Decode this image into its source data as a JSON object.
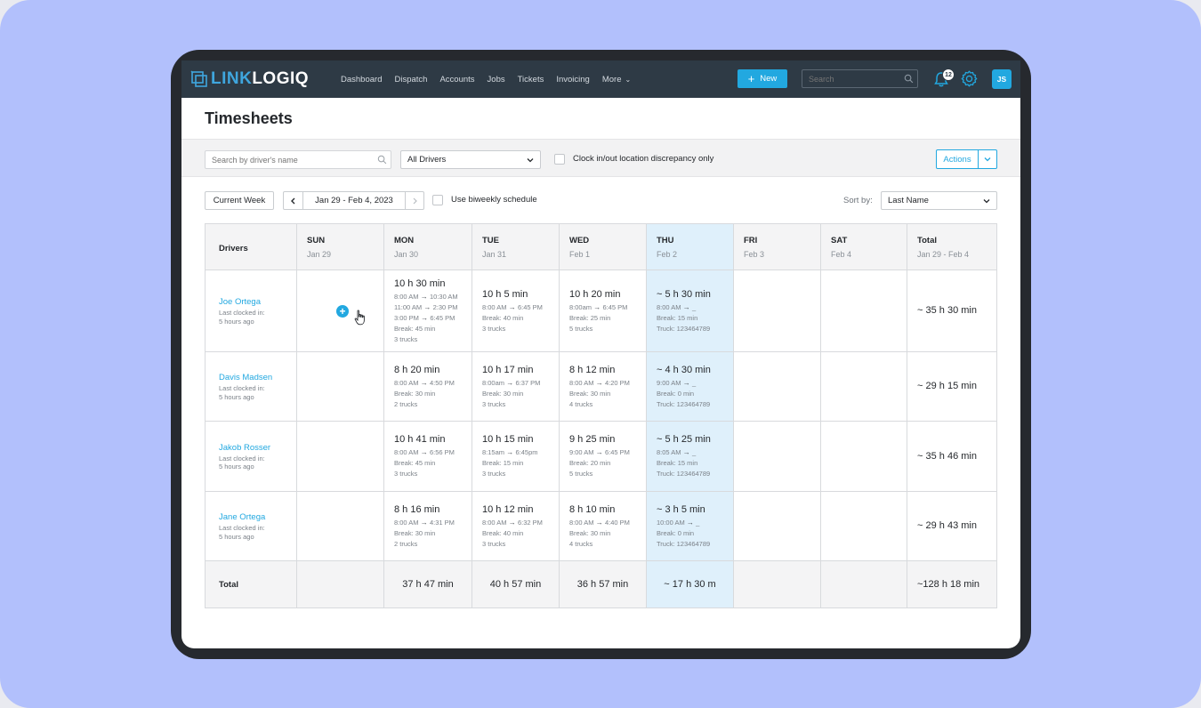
{
  "brand": {
    "logo_part1": "LINK",
    "logo_part2": "LOGIQ"
  },
  "nav": {
    "links": [
      "Dashboard",
      "Dispatch",
      "Accounts",
      "Jobs",
      "Tickets",
      "Invoicing",
      "More"
    ],
    "new_label": "New",
    "search_placeholder": "Search",
    "notification_count": "12",
    "user_initials": "JS"
  },
  "page": {
    "title": "Timesheets"
  },
  "filters": {
    "driver_search_placeholder": "Search by driver's name",
    "drivers_select": "All Drivers",
    "discrepancy_label": "Clock in/out location discrepancy only",
    "actions_label": "Actions"
  },
  "week": {
    "current_week_label": "Current Week",
    "range_label": "Jan 29 - Feb 4, 2023",
    "biweekly_label": "Use biweekly schedule",
    "sort_by_label": "Sort by:",
    "sort_value": "Last Name"
  },
  "table": {
    "drivers_header": "Drivers",
    "total_row_label": "Total",
    "columns": [
      {
        "day": "SUN",
        "date": "Jan 29"
      },
      {
        "day": "MON",
        "date": "Jan 30"
      },
      {
        "day": "TUE",
        "date": "Jan 31"
      },
      {
        "day": "WED",
        "date": "Feb 1"
      },
      {
        "day": "THU",
        "date": "Feb 2"
      },
      {
        "day": "FRI",
        "date": "Feb 3"
      },
      {
        "day": "SAT",
        "date": "Feb 4"
      },
      {
        "day": "Total",
        "date": "Jan 29 - Feb 4"
      }
    ],
    "drivers": [
      {
        "name": "Joe Ortega",
        "last_clocked_label": "Last clocked in:",
        "last_clocked": "5 hours ago",
        "total": "~ 35 h 30 min",
        "days": {
          "mon": {
            "time": "10 h 30 min",
            "shifts": [
              [
                "8:00 AM",
                "10:30 AM"
              ],
              [
                "11:00 AM",
                "2:30 PM"
              ],
              [
                "3:00 PM",
                "6:45 PM"
              ]
            ],
            "break": "Break: 45 min",
            "trucks": "3 trucks"
          },
          "tue": {
            "time": "10 h 5 min",
            "shifts": [
              [
                "8:00 AM",
                "6:45 PM"
              ]
            ],
            "break": "Break: 40 min",
            "trucks": "3 trucks"
          },
          "wed": {
            "time": "10 h 20 min",
            "shifts": [
              [
                "8:00am",
                "6:45 PM"
              ]
            ],
            "break": "Break: 25 min",
            "trucks": "5 trucks"
          },
          "thu": {
            "time": "~ 5 h 30 min",
            "shifts": [
              [
                "8:00 AM",
                "_"
              ]
            ],
            "break": "Break: 15 min",
            "trucks": "Truck: 123464789"
          }
        }
      },
      {
        "name": "Davis Madsen",
        "last_clocked_label": "Last clocked in:",
        "last_clocked": "5 hours ago",
        "total": "~ 29 h 15 min",
        "days": {
          "mon": {
            "time": "8 h 20 min",
            "shifts": [
              [
                "8:00 AM",
                "4:50 PM"
              ]
            ],
            "break": "Break: 30 min",
            "trucks": "2 trucks"
          },
          "tue": {
            "time": "10 h 17 min",
            "shifts": [
              [
                "8:00am",
                "6:37 PM"
              ]
            ],
            "break": "Break: 30 min",
            "trucks": "3 trucks"
          },
          "wed": {
            "time": "8 h 12 min",
            "shifts": [
              [
                "8:00 AM",
                "4:20 PM"
              ]
            ],
            "break": "Break: 30 min",
            "trucks": "4 trucks"
          },
          "thu": {
            "time": "~ 4 h 30 min",
            "shifts": [
              [
                "9:00 AM",
                "_"
              ]
            ],
            "break": "Break: 0 min",
            "trucks": "Truck: 123464789"
          }
        }
      },
      {
        "name": "Jakob Rosser",
        "last_clocked_label": "Last clocked in:",
        "last_clocked": "5 hours ago",
        "total": "~ 35 h 46 min",
        "days": {
          "mon": {
            "time": "10 h 41 min",
            "shifts": [
              [
                "8:00 AM",
                "6:56 PM"
              ]
            ],
            "break": "Break: 45 min",
            "trucks": "3 trucks"
          },
          "tue": {
            "time": "10 h 15 min",
            "shifts": [
              [
                "8:15am",
                "6:45pm"
              ]
            ],
            "break": "Break: 15 min",
            "trucks": "3 trucks"
          },
          "wed": {
            "time": "9 h 25 min",
            "shifts": [
              [
                "9:00 AM",
                "6:45 PM"
              ]
            ],
            "break": "Break: 20 min",
            "trucks": "5 trucks"
          },
          "thu": {
            "time": "~ 5 h 25 min",
            "shifts": [
              [
                "8:05 AM",
                "_"
              ]
            ],
            "break": "Break: 15 min",
            "trucks": "Truck: 123464789"
          }
        }
      },
      {
        "name": "Jane Ortega",
        "last_clocked_label": "Last clocked in:",
        "last_clocked": "5 hours ago",
        "total": "~ 29 h 43 min",
        "days": {
          "mon": {
            "time": "8 h 16 min",
            "shifts": [
              [
                "8:00 AM",
                "4:31 PM"
              ]
            ],
            "break": "Break: 30 min",
            "trucks": "2 trucks"
          },
          "tue": {
            "time": "10 h 12 min",
            "shifts": [
              [
                "8:00 AM",
                "6:32 PM"
              ]
            ],
            "break": "Break: 40 min",
            "trucks": "3 trucks"
          },
          "wed": {
            "time": "8 h 10 min",
            "shifts": [
              [
                "8:00 AM",
                "4:40 PM"
              ]
            ],
            "break": "Break: 30 min",
            "trucks": "4 trucks"
          },
          "thu": {
            "time": "~ 3 h 5 min",
            "shifts": [
              [
                "10:00 AM",
                "_"
              ]
            ],
            "break": "Break: 0 min",
            "trucks": "Truck: 123464789"
          }
        }
      }
    ],
    "totals": {
      "mon": "37 h 47 min",
      "tue": "40 h 57 min",
      "wed": "36 h 57 min",
      "thu": "~ 17 h 30 m",
      "week": "~128 h 18 min"
    }
  },
  "colors": {
    "accent": "#22a8e0",
    "nav_bg": "#2e3a45",
    "today_bg": "#dff0fb",
    "frame": "#b2c0fc"
  }
}
